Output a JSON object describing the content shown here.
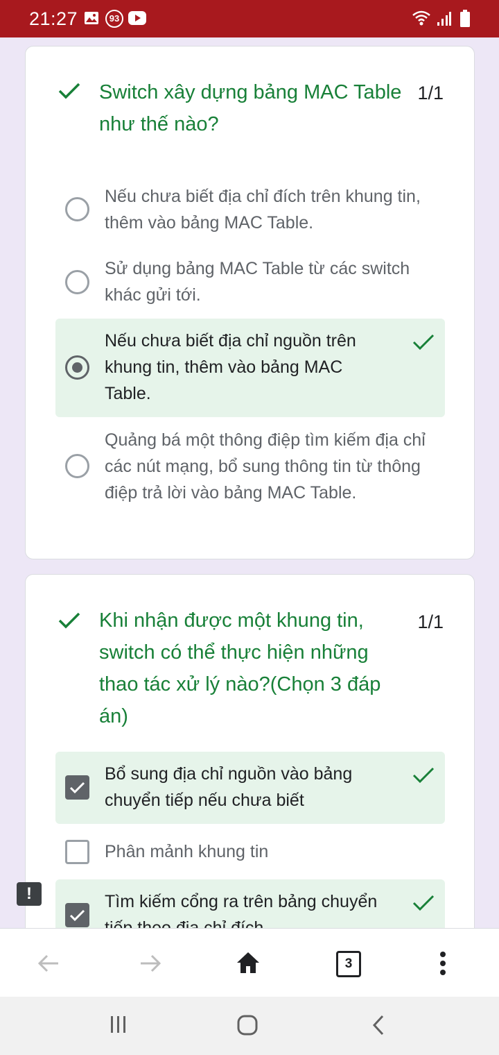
{
  "status_bar": {
    "time": "21:27",
    "notification_count": "93",
    "icons": [
      "gallery-icon",
      "notification-count-icon",
      "youtube-icon",
      "wifi-icon",
      "signal-icon",
      "battery-icon"
    ],
    "background": "#a8191e"
  },
  "questions": [
    {
      "title": "Switch xây dựng bảng MAC Table như thế nào?",
      "score": "1/1",
      "type": "radio",
      "options": [
        {
          "label": "Nếu chưa biết địa chỉ đích trên khung tin, thêm vào bảng MAC Table.",
          "selected": false,
          "correct": false
        },
        {
          "label": "Sử dụng bảng MAC Table từ các switch khác gửi tới.",
          "selected": false,
          "correct": false
        },
        {
          "label": "Nếu chưa biết địa chỉ nguồn trên khung tin, thêm vào bảng MAC Table.",
          "selected": true,
          "correct": true
        },
        {
          "label": "Quảng bá một thông điệp tìm kiếm địa chỉ các nút mạng, bổ sung thông tin từ thông điệp trả lời vào bảng MAC Table.",
          "selected": false,
          "correct": false
        }
      ]
    },
    {
      "title": "Khi nhận được một khung tin, switch có thể thực hiện những thao tác xử lý nào?(Chọn 3 đáp án)",
      "score": "1/1",
      "type": "checkbox",
      "options": [
        {
          "label": "Bổ sung địa chỉ nguồn vào bảng chuyển tiếp nếu chưa biết",
          "selected": true,
          "correct": true
        },
        {
          "label": "Phân mảnh khung tin",
          "selected": false,
          "correct": false
        },
        {
          "label": "Tìm kiếm cổng ra trên bảng chuyển tiếp theo địa chỉ đích",
          "selected": true,
          "correct": true
        }
      ]
    }
  ],
  "report_icon": "!",
  "browser_bar": {
    "tab_count": "3",
    "icons": [
      "back-arrow-icon",
      "forward-arrow-icon",
      "home-icon",
      "tab-switcher-icon",
      "more-options-icon"
    ]
  },
  "nav_bar": {
    "icons": [
      "recent-apps-icon",
      "home-button-icon",
      "back-icon"
    ]
  },
  "colors": {
    "correct_green": "#188038",
    "correct_bg": "#e6f4ea",
    "page_bg": "#ede7f6"
  }
}
